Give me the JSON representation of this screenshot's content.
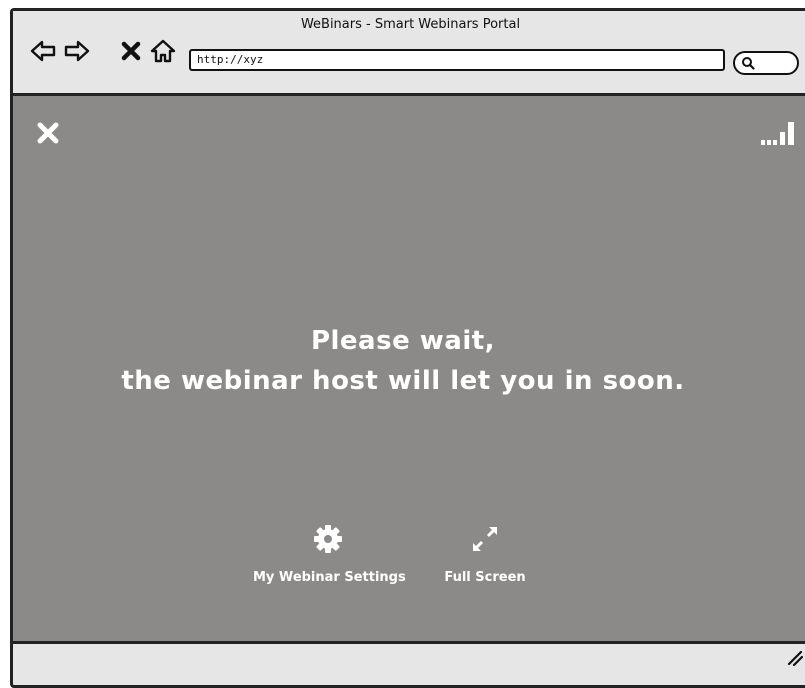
{
  "window": {
    "title": "WeBinars - Smart Webinars Portal"
  },
  "toolbar": {
    "url": "http://xyz",
    "icons": [
      "back-arrow-icon",
      "forward-arrow-icon",
      "stop-icon",
      "home-icon",
      "search-icon"
    ]
  },
  "page": {
    "message_line1": "Please wait,",
    "message_line2": "the webinar host will let you in soon."
  },
  "actions": {
    "settings_label": "My Webinar Settings",
    "fullscreen_label": "Full Screen"
  },
  "colors": {
    "content_bg": "#8c8a89",
    "chrome_bg": "#e6e6e6",
    "text_on_content": "#ffffff"
  }
}
